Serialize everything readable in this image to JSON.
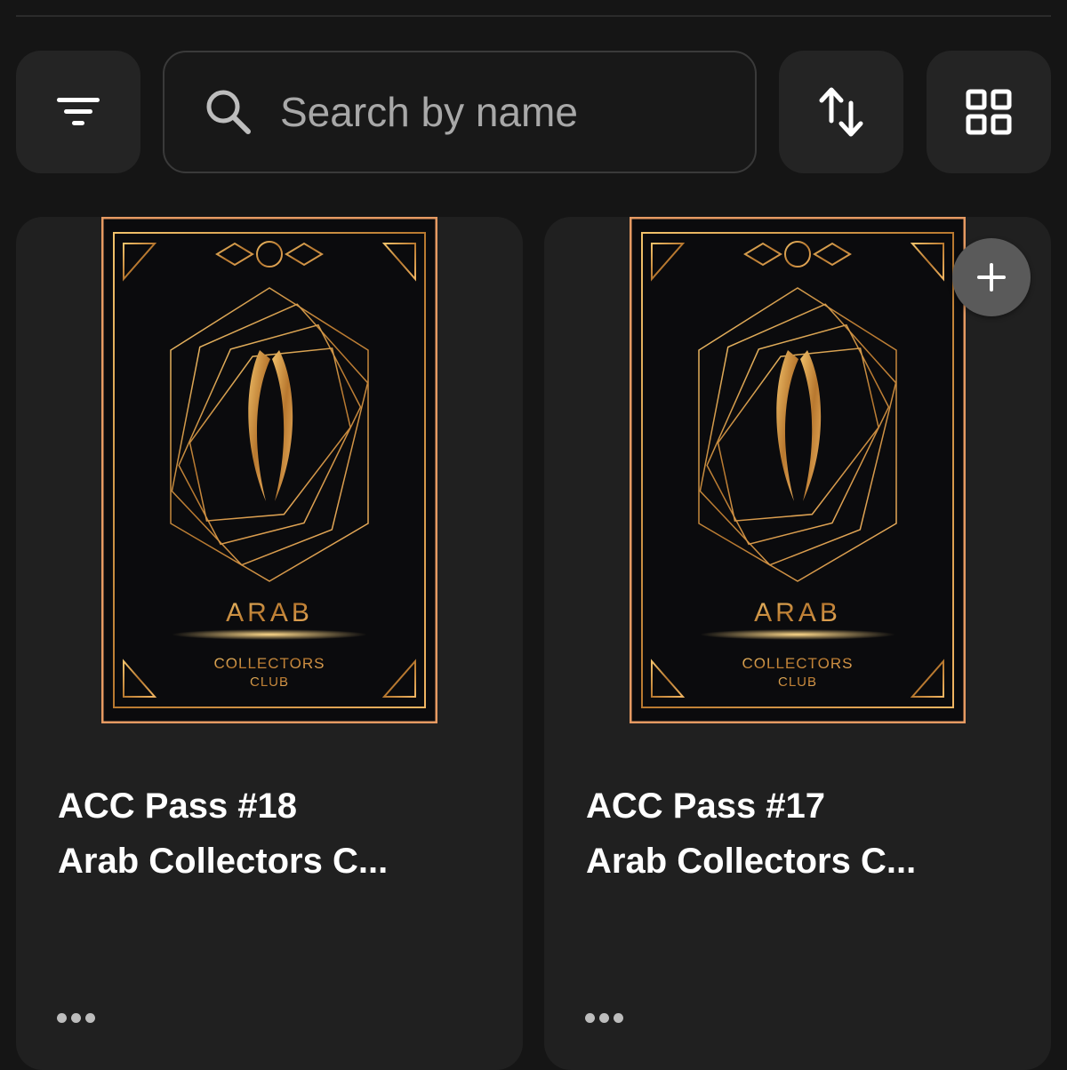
{
  "toolbar": {
    "filter_icon": "filter-icon",
    "search_placeholder": "Search by name",
    "search_value": "",
    "sort_icon": "sort-icon",
    "view_icon": "grid-view-icon"
  },
  "colors": {
    "background": "#151515",
    "card": "#202020",
    "gold": "#d4a24c",
    "border_copper": "#e0925a"
  },
  "cards": [
    {
      "title": "ACC Pass #18",
      "collection": "Arab Collectors C...",
      "art_word": "ARAB",
      "art_sub1": "COLLECTORS",
      "art_sub2": "CLUB"
    },
    {
      "title": "ACC Pass #17",
      "collection": "Arab Collectors C...",
      "art_word": "ARAB",
      "art_sub1": "COLLECTORS",
      "art_sub2": "CLUB"
    }
  ],
  "add_button_icon": "plus-icon"
}
